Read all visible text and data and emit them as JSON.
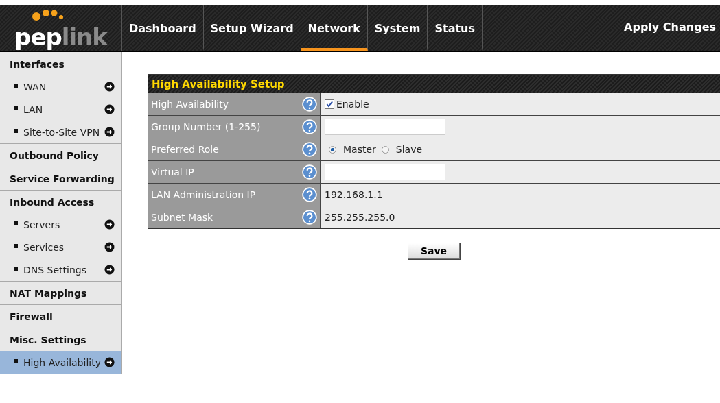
{
  "logo": {
    "part_1": "pep",
    "part_2": "link"
  },
  "nav": [
    {
      "label": "Dashboard",
      "selected": false
    },
    {
      "label": "Setup Wizard",
      "selected": false
    },
    {
      "label": "Network",
      "selected": true
    },
    {
      "label": "System",
      "selected": false
    },
    {
      "label": "Status",
      "selected": false
    }
  ],
  "apply_changes": "Apply Changes",
  "sidebar": [
    {
      "title": "Interfaces",
      "children": [
        {
          "label": "WAN",
          "selected": false
        },
        {
          "label": "LAN",
          "selected": false
        },
        {
          "label": "Site-to-Site VPN",
          "selected": false
        }
      ]
    },
    {
      "title": "Outbound Policy"
    },
    {
      "title": "Service Forwarding"
    },
    {
      "title": "Inbound Access",
      "children": [
        {
          "label": "Servers",
          "selected": false
        },
        {
          "label": "Services",
          "selected": false
        },
        {
          "label": "DNS Settings",
          "selected": false
        }
      ]
    },
    {
      "title": "NAT Mappings"
    },
    {
      "title": "Firewall"
    },
    {
      "title": "Misc. Settings",
      "children": [
        {
          "label": "High Availability",
          "selected": true
        }
      ]
    }
  ],
  "panel": {
    "title": "High Availability Setup",
    "rows": [
      {
        "label": "High Availability",
        "kind": "checkbox",
        "checked": true,
        "text": "Enable"
      },
      {
        "label": "Group Number (1-255)",
        "kind": "input"
      },
      {
        "label": "Preferred Role",
        "kind": "radio",
        "options": [
          {
            "label": "Master",
            "selected": true
          },
          {
            "label": "Slave",
            "selected": false
          }
        ]
      },
      {
        "label": "Virtual IP",
        "kind": "input"
      },
      {
        "label": "LAN Administration IP",
        "kind": "text",
        "value": "192.168.1.1"
      },
      {
        "label": "Subnet Mask",
        "kind": "text",
        "value": "255.255.255.0"
      }
    ]
  },
  "save": "Save"
}
